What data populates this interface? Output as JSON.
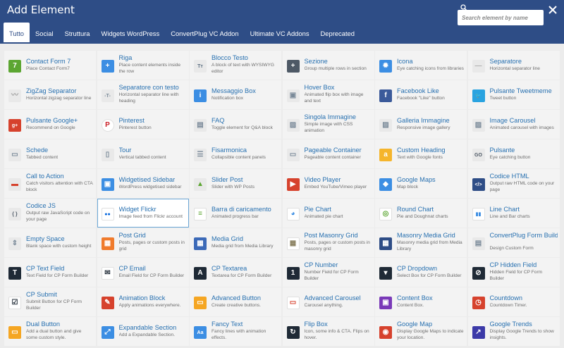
{
  "window": {
    "title": "Add Element"
  },
  "search": {
    "placeholder": "Search element by name"
  },
  "tabs": [
    {
      "label": "Tutto",
      "active": true
    },
    {
      "label": "Social",
      "active": false
    },
    {
      "label": "Struttura",
      "active": false
    },
    {
      "label": "Widgets WordPress",
      "active": false
    },
    {
      "label": "ConvertPlug VC Addon",
      "active": false
    },
    {
      "label": "Ultimate VC Addons",
      "active": false
    },
    {
      "label": "Deprecated",
      "active": false
    }
  ],
  "colors": {
    "header": "#2e4d86",
    "link": "#2770b0",
    "selected_border": "#6aa6d6"
  },
  "elements": [
    {
      "name": "Contact Form 7",
      "desc": "Place Contact Form7",
      "icon": "contact-form-7-icon",
      "color": "#5ca632",
      "glyph": "7"
    },
    {
      "name": "Riga",
      "desc": "Place content elements inside the row",
      "icon": "plus-icon",
      "color": "#3c8ee3",
      "glyph": "+"
    },
    {
      "name": "Blocco Testo",
      "desc": "A block of text with WYSIWYG editor",
      "icon": "text-block-icon",
      "color": "#e9e9e9",
      "glyph": "Tт",
      "fg": "#5a6d80"
    },
    {
      "name": "Sezione",
      "desc": "Group multiple rows in section",
      "icon": "section-plus-icon",
      "color": "#4e5966",
      "glyph": "+"
    },
    {
      "name": "Icona",
      "desc": "Eye catching icons from libraries",
      "icon": "icon-library-icon",
      "color": "#3c8ee3",
      "glyph": "✹"
    },
    {
      "name": "Separatore",
      "desc": "Horizontal separator line",
      "icon": "separator-icon",
      "color": "#e9e9e9",
      "glyph": "—",
      "fg": "#b0b0b0"
    },
    {
      "name": "ZigZag Separator",
      "desc": "Horizontal zigzag separator line",
      "icon": "zigzag-separator-icon",
      "color": "#e9e9e9",
      "glyph": "〰",
      "fg": "#a0a0a0"
    },
    {
      "name": "Separatore con testo",
      "desc": "Horizontal separator line with heading",
      "icon": "text-separator-icon",
      "color": "#e9e9e9",
      "glyph": "-T-",
      "fg": "#7a8a99"
    },
    {
      "name": "Messaggio Box",
      "desc": "Notification box",
      "icon": "info-icon",
      "color": "#3c8ee3",
      "glyph": "i"
    },
    {
      "name": "Hover Box",
      "desc": "Animated flip box with image and text",
      "icon": "hover-box-icon",
      "color": "#e9e9e9",
      "glyph": "▣",
      "fg": "#7a8a99"
    },
    {
      "name": "Facebook Like",
      "desc": "Facebook \"Like\" button",
      "icon": "facebook-icon",
      "color": "#3b5a9a",
      "glyph": "f"
    },
    {
      "name": "Pulsante Tweetmeme",
      "desc": "Tweet button",
      "icon": "twitter-icon",
      "color": "#29a3e0",
      "glyph": "🐦"
    },
    {
      "name": "Pulsante Google+",
      "desc": "Recommend on Google",
      "icon": "google-plus-icon",
      "color": "#d6422d",
      "glyph": "g+"
    },
    {
      "name": "Pinterest",
      "desc": "Pinterest button",
      "icon": "pinterest-icon",
      "color": "#ffffff",
      "glyph": "P",
      "fg": "#cb2027",
      "round": true
    },
    {
      "name": "FAQ",
      "desc": "Toggle element for Q&A block",
      "icon": "faq-icon",
      "color": "#e9e9e9",
      "glyph": "▤",
      "fg": "#7a8a99"
    },
    {
      "name": "Singola Immagine",
      "desc": "Simple image with CSS animation",
      "icon": "image-icon",
      "color": "#e9e9e9",
      "glyph": "▨",
      "fg": "#7a8a99"
    },
    {
      "name": "Galleria Immagine",
      "desc": "Responsive image gallery",
      "icon": "gallery-icon",
      "color": "#e9e9e9",
      "glyph": "▨",
      "fg": "#7a8a99"
    },
    {
      "name": "Image Carousel",
      "desc": "Animated carousel with images",
      "icon": "carousel-icon",
      "color": "#e9e9e9",
      "glyph": "▨",
      "fg": "#7a8a99"
    },
    {
      "name": "Schede",
      "desc": "Tabbed content",
      "icon": "tabs-icon",
      "color": "#e9e9e9",
      "glyph": "▭",
      "fg": "#7a8a99"
    },
    {
      "name": "Tour",
      "desc": "Vertical tabbed content",
      "icon": "tour-icon",
      "color": "#e9e9e9",
      "glyph": "▯",
      "fg": "#7a8a99"
    },
    {
      "name": "Fisarmonica",
      "desc": "Collapsible content panels",
      "icon": "accordion-icon",
      "color": "#e9e9e9",
      "glyph": "☰",
      "fg": "#7a8a99"
    },
    {
      "name": "Pageable Container",
      "desc": "Pageable content container",
      "icon": "pageable-container-icon",
      "color": "#e9e9e9",
      "glyph": "▭",
      "fg": "#7a8a99"
    },
    {
      "name": "Custom Heading",
      "desc": "Text with Google fonts",
      "icon": "custom-heading-icon",
      "color": "#f5b52c",
      "glyph": "a"
    },
    {
      "name": "Pulsante",
      "desc": "Eye catching button",
      "icon": "button-go-icon",
      "color": "#e9e9e9",
      "glyph": "GO",
      "fg": "#4e5966"
    },
    {
      "name": "Call to Action",
      "desc": "Catch visitors attention with CTA block",
      "icon": "call-to-action-icon",
      "color": "#e9e9e9",
      "glyph": "▬",
      "fg": "#d6422d"
    },
    {
      "name": "Widgetised Sidebar",
      "desc": "WordPress widgetised sidebar",
      "icon": "sidebar-icon",
      "color": "#3c8ee3",
      "glyph": "▣"
    },
    {
      "name": "Slider Post",
      "desc": "Slider with WP Posts",
      "icon": "post-slider-icon",
      "color": "#e9e9e9",
      "glyph": "▲",
      "fg": "#5ca632"
    },
    {
      "name": "Video Player",
      "desc": "Embed YouTube/Vimeo player",
      "icon": "video-player-icon",
      "color": "#d6422d",
      "glyph": "▶"
    },
    {
      "name": "Google Maps",
      "desc": "Map block",
      "icon": "google-maps-icon",
      "color": "#3c8ee3",
      "glyph": "◆"
    },
    {
      "name": "Codice HTML",
      "desc": "Output raw HTML code on your page",
      "icon": "html-code-icon",
      "color": "#2e4d86",
      "glyph": "</>"
    },
    {
      "name": "Codice JS",
      "desc": "Output raw JavaScript code on your page",
      "icon": "js-code-icon",
      "color": "#e9e9e9",
      "glyph": "{ }",
      "fg": "#4e5966"
    },
    {
      "name": "Widget Flickr",
      "desc": "Image feed from Flickr account",
      "icon": "flickr-icon",
      "color": "#ffffff",
      "glyph": "●●",
      "fg": "#0063dc",
      "selected": true
    },
    {
      "name": "Barra di caricamento",
      "desc": "Animated progress bar",
      "icon": "progress-bar-icon",
      "color": "#ffffff",
      "glyph": "≡",
      "fg": "#5ca632"
    },
    {
      "name": "Pie Chart",
      "desc": "Animated pie chart",
      "icon": "pie-chart-icon",
      "color": "#ffffff",
      "glyph": "◕",
      "fg": "#3c8ee3"
    },
    {
      "name": "Round Chart",
      "desc": "Pie and Doughnat charts",
      "icon": "round-chart-icon",
      "color": "#ffffff",
      "glyph": "◎",
      "fg": "#5ca632"
    },
    {
      "name": "Line Chart",
      "desc": "Line and Bar charts",
      "icon": "line-chart-icon",
      "color": "#ffffff",
      "glyph": "▮▮",
      "fg": "#3c8ee3"
    },
    {
      "name": "Empty Space",
      "desc": "Blank space with custom height",
      "icon": "empty-space-icon",
      "color": "#e9e9e9",
      "glyph": "⇕",
      "fg": "#7a8a99"
    },
    {
      "name": "Post Grid",
      "desc": "Posts, pages or custom posts in grid",
      "icon": "post-grid-icon",
      "color": "#f07b2c",
      "glyph": "▦"
    },
    {
      "name": "Media Grid",
      "desc": "Media grid from Media Library",
      "icon": "media-grid-icon",
      "color": "#3c6ab8",
      "glyph": "▦"
    },
    {
      "name": "Post Masonry Grid",
      "desc": "Posts, pages or custom posts in masonry grid",
      "icon": "post-masonry-grid-icon",
      "color": "#ffffff",
      "glyph": "▦",
      "fg": "#8a8060"
    },
    {
      "name": "Masonry Media Grid",
      "desc": "Masonry media grid from Media Library",
      "icon": "masonry-media-grid-icon",
      "color": "#2e4d86",
      "glyph": "▦"
    },
    {
      "name": "ConvertPlug Form Builder",
      "desc": "Design Custom Form",
      "icon": "convertplug-form-icon",
      "color": "#e9e9e9",
      "glyph": "▤",
      "fg": "#7a8a99"
    },
    {
      "name": "CP Text Field",
      "desc": "Text Field for CP Form Builder",
      "icon": "cp-text-field-icon",
      "color": "#1f2a36",
      "glyph": "T"
    },
    {
      "name": "CP Email",
      "desc": "Email Field for CP Form Builder",
      "icon": "cp-email-icon",
      "color": "#ffffff",
      "glyph": "✉",
      "fg": "#1f2a36"
    },
    {
      "name": "CP Textarea",
      "desc": "Textarea for CP Form Builder",
      "icon": "cp-textarea-icon",
      "color": "#1f2a36",
      "glyph": "A"
    },
    {
      "name": "CP Number",
      "desc": "Number Field for CP Form Builder",
      "icon": "cp-number-icon",
      "color": "#1f2a36",
      "glyph": "1"
    },
    {
      "name": "CP Dropdown",
      "desc": "Select Box for CP Form Builder",
      "icon": "cp-dropdown-icon",
      "color": "#1f2a36",
      "glyph": "▾"
    },
    {
      "name": "CP Hidden Field",
      "desc": "Hidden Field for CP Form Builder",
      "icon": "cp-hidden-field-icon",
      "color": "#1f2a36",
      "glyph": "⊘"
    },
    {
      "name": "CP Submit",
      "desc": "Submit Button for CP Form Builder",
      "icon": "cp-submit-icon",
      "color": "#ffffff",
      "glyph": "☑",
      "fg": "#1f2a36"
    },
    {
      "name": "Animation Block",
      "desc": "Apply animations everywhere.",
      "icon": "animation-block-icon",
      "color": "#d6422d",
      "glyph": "✎"
    },
    {
      "name": "Advanced Button",
      "desc": "Create creative buttons.",
      "icon": "advanced-button-icon",
      "color": "#f5a623",
      "glyph": "▭"
    },
    {
      "name": "Advanced Carousel",
      "desc": "Carousel anything.",
      "icon": "advanced-carousel-icon",
      "color": "#ffffff",
      "glyph": "▭",
      "fg": "#d6422d"
    },
    {
      "name": "Content Box",
      "desc": "Content Box.",
      "icon": "content-box-icon",
      "color": "#7a3ab8",
      "glyph": "▣"
    },
    {
      "name": "Countdown",
      "desc": "Countdown Timer.",
      "icon": "countdown-icon",
      "color": "#d6422d",
      "glyph": "◷"
    },
    {
      "name": "Dual Button",
      "desc": "Add a dual button and give some custom style.",
      "icon": "dual-button-icon",
      "color": "#f5a623",
      "glyph": "▭"
    },
    {
      "name": "Expandable Section",
      "desc": "Add a Expandable Section.",
      "icon": "expandable-section-icon",
      "color": "#3c8ee3",
      "glyph": "⤢"
    },
    {
      "name": "Fancy Text",
      "desc": "Fancy lines with animation effects.",
      "icon": "fancy-text-icon",
      "color": "#3c8ee3",
      "glyph": "Aa"
    },
    {
      "name": "Flip Box",
      "desc": "Icon, some info & CTA. Flips on hover.",
      "icon": "flip-box-icon",
      "color": "#1f2a36",
      "glyph": "↻"
    },
    {
      "name": "Google Map",
      "desc": "Display Google Maps to indicate your location.",
      "icon": "google-map-icon",
      "color": "#d6422d",
      "glyph": "◉"
    },
    {
      "name": "Google Trends",
      "desc": "Display Google Trends to show insights.",
      "icon": "google-trends-icon",
      "color": "#3c3aa8",
      "glyph": "↗"
    }
  ]
}
